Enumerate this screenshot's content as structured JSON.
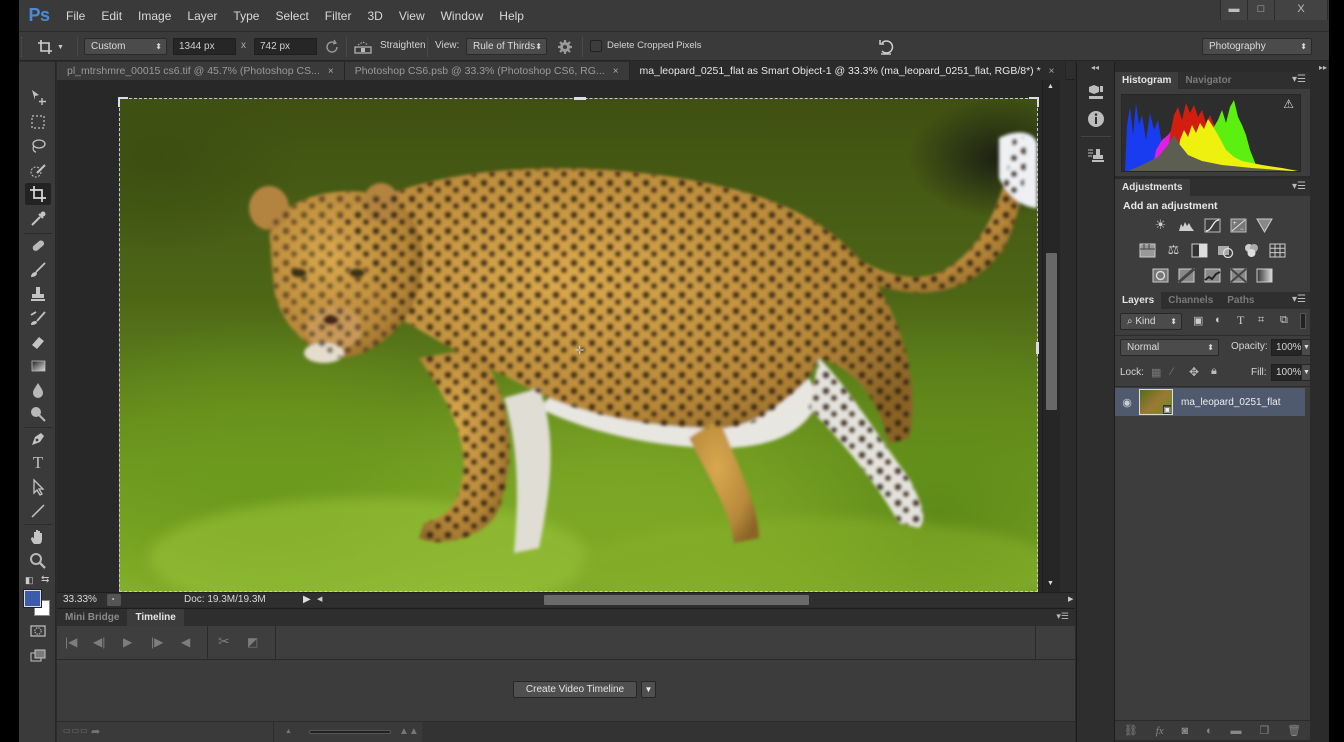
{
  "app": {
    "logo": "Ps",
    "menu": [
      "File",
      "Edit",
      "Image",
      "Layer",
      "Type",
      "Select",
      "Filter",
      "3D",
      "View",
      "Window",
      "Help"
    ],
    "window_controls": {
      "minimize": "▬",
      "maximize": "□",
      "close": "X"
    }
  },
  "options_bar": {
    "tool_icon": "crop-icon",
    "ratio_preset": "Custom",
    "width_value": "1344 px",
    "times_label": "x",
    "height_value": "742 px",
    "straighten_label": "Straighten",
    "view_label": "View:",
    "view_value": "Rule of Thirds",
    "delete_cropped_label": "Delete Cropped Pixels",
    "delete_cropped_checked": false,
    "workspace": "Photography"
  },
  "doc_tabs": [
    {
      "label": "pl_mtrshmre_00015 cs6.tif @ 45.7% (Photoshop CS...",
      "active": false
    },
    {
      "label": "Photoshop CS6.psb @ 33.3% (Photoshop CS6, RG...",
      "active": false
    },
    {
      "label": "ma_leopard_0251_flat as Smart Object-1 @ 33.3% (ma_leopard_0251_flat, RGB/8*) *",
      "active": true
    }
  ],
  "tab_close": "×",
  "status": {
    "zoom": "33.33%",
    "doc_size": "Doc: 19.3M/19.3M"
  },
  "timeline_panel": {
    "tabs": [
      {
        "label": "Mini Bridge",
        "active": false
      },
      {
        "label": "Timeline",
        "active": true
      }
    ],
    "create_button": "Create Video Timeline",
    "dropdown_glyph": "▼"
  },
  "histogram_panel": {
    "tabs": [
      {
        "label": "Histogram",
        "active": true
      },
      {
        "label": "Navigator",
        "active": false
      }
    ],
    "warning_glyph": "⚠"
  },
  "adjustments_panel": {
    "tabs": [
      {
        "label": "Adjustments",
        "active": true
      }
    ],
    "heading": "Add an adjustment",
    "rows": [
      [
        "brightness-contrast",
        "levels",
        "curves",
        "exposure",
        "vibrance"
      ],
      [
        "hue-saturation",
        "color-balance",
        "black-white",
        "photo-filter",
        "channel-mixer",
        "color-lookup"
      ],
      [
        "invert",
        "posterize",
        "threshold",
        "selective-color",
        "gradient-map"
      ]
    ]
  },
  "layers_panel": {
    "tabs": [
      {
        "label": "Layers",
        "active": true
      },
      {
        "label": "Channels",
        "active": false
      },
      {
        "label": "Paths",
        "active": false
      }
    ],
    "filter_kind": "Kind",
    "blend_mode": "Normal",
    "opacity_label": "Opacity:",
    "opacity_value": "100%",
    "lock_label": "Lock:",
    "fill_label": "Fill:",
    "fill_value": "100%",
    "layers": [
      {
        "name": "ma_leopard_0251_flat",
        "visible": true,
        "selected": true,
        "smart_object": true
      }
    ]
  },
  "colors": {
    "foreground": "#3d5bab",
    "background": "#ffffff",
    "accent": "#4b8bd6",
    "selected_layer": "#4f5a6e"
  }
}
